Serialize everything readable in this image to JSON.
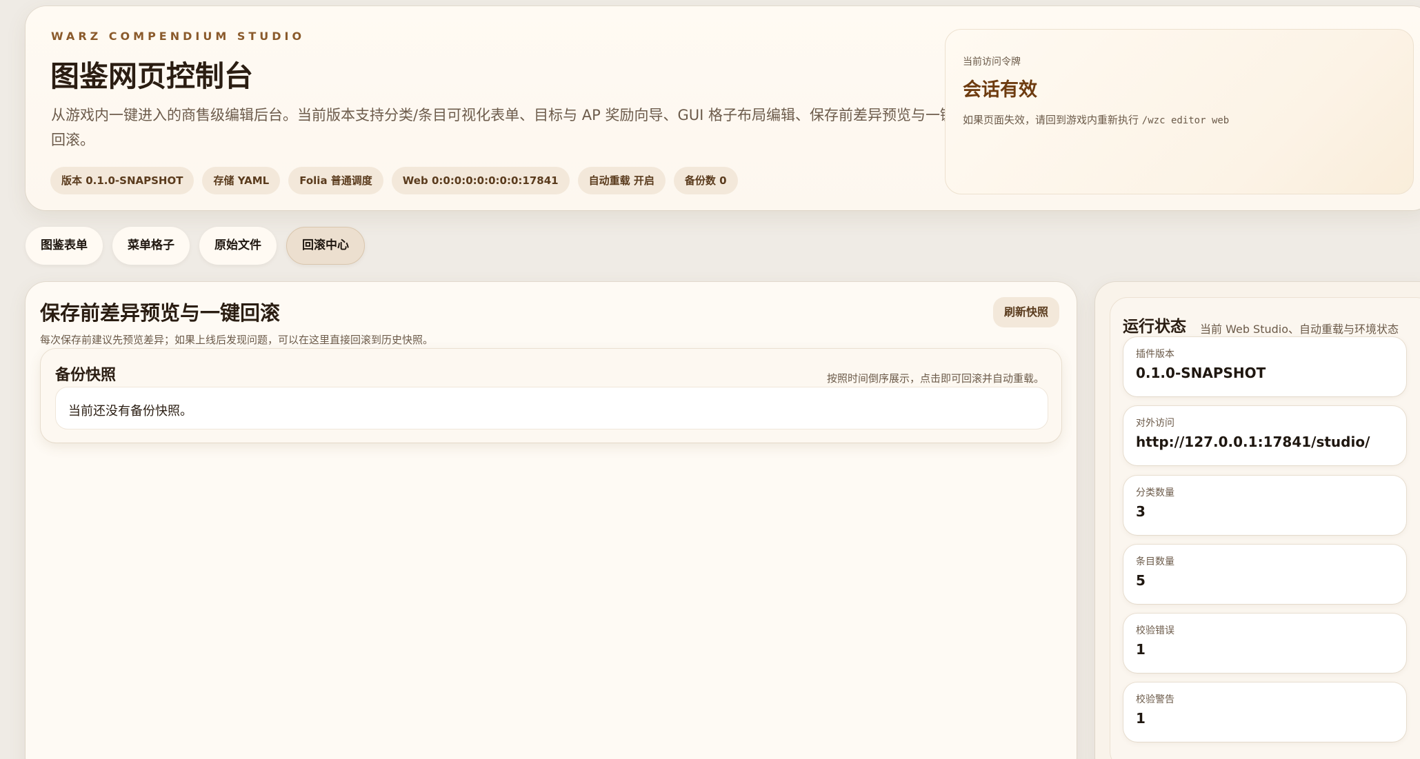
{
  "hero": {
    "eyebrow": "WARZ COMPENDIUM STUDIO",
    "title": "图鉴网页控制台",
    "description": "从游戏内一键进入的商售级编辑后台。当前版本支持分类/条目可视化表单、目标与 AP 奖励向导、GUI 格子布局编辑、保存前差异预览与一键回滚。",
    "chips": [
      "版本 0.1.0-SNAPSHOT",
      "存储 YAML",
      "Folia 普通调度",
      "Web 0:0:0:0:0:0:0:0:17841",
      "自动重载 开启",
      "备份数 0"
    ]
  },
  "token": {
    "label": "当前访问令牌",
    "state": "会话有效",
    "hint_prefix": "如果页面失效，请回到游戏内重新执行",
    "hint_command": "/wzc editor web"
  },
  "tabs": [
    "图鉴表单",
    "菜单格子",
    "原始文件",
    "回滚中心"
  ],
  "active_tab": "回滚中心",
  "rollback": {
    "title": "保存前差异预览与一键回滚",
    "subtitle": "每次保存前建议先预览差异；如果上线后发现问题，可以在这里直接回滚到历史快照。",
    "refresh_label": "刷新快照",
    "backup_title": "备份快照",
    "backup_note": "按照时间倒序展示，点击即可回滚并自动重载。",
    "empty_text": "当前还没有备份快照。"
  },
  "status": {
    "title": "运行状态",
    "subtitle": "当前 Web Studio、自动重载与环境状态",
    "items": [
      {
        "label": "插件版本",
        "value": "0.1.0-SNAPSHOT"
      },
      {
        "label": "对外访问",
        "value": "http://127.0.0.1:17841/studio/"
      },
      {
        "label": "分类数量",
        "value": "3"
      },
      {
        "label": "条目数量",
        "value": "5"
      },
      {
        "label": "校验错误",
        "value": "1"
      },
      {
        "label": "校验警告",
        "value": "1"
      }
    ]
  }
}
